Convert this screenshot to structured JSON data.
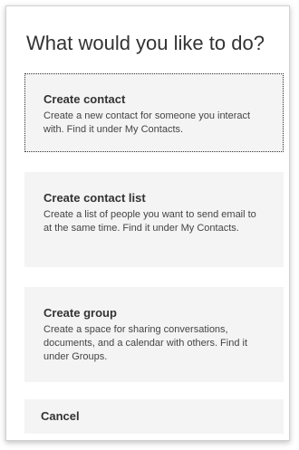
{
  "dialog": {
    "title": "What would you like to do?",
    "options": [
      {
        "title": "Create contact",
        "description": "Create a new contact for someone you interact with. Find it under My Contacts."
      },
      {
        "title": "Create contact list",
        "description": "Create a list of people you want to send email to at the same time. Find it under My Contacts."
      },
      {
        "title": "Create group",
        "description": "Create a space for sharing conversations, documents, and a calendar with others. Find it under Groups."
      }
    ],
    "cancel_label": "Cancel"
  }
}
